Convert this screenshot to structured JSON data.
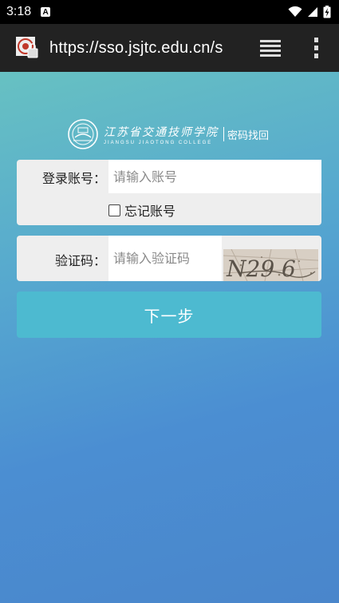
{
  "status_bar": {
    "time": "3:18",
    "notification_badge": "A",
    "icons": [
      "wifi-icon",
      "signal-icon",
      "battery-charging-icon"
    ]
  },
  "browser": {
    "url": "https://sso.jsjtc.edu.cn/s",
    "site_icon": "site-favicon",
    "tabs_icon": "tabs-icon",
    "menu_icon": "more-vert-icon"
  },
  "header": {
    "school_name_cn": "江苏省交通技师学院",
    "school_name_en": "JIANGSU JIAOTONG COLLEGE",
    "reset_password_link": "密码找回"
  },
  "login_form": {
    "account_label": "登录账号：",
    "account_placeholder": "请输入账号",
    "account_value": "",
    "remember_checked": false,
    "remember_label": "忘记账号",
    "captcha_label": "验证码：",
    "captcha_placeholder": "请输入验证码",
    "captcha_value": "",
    "captcha_text": "N29 6",
    "next_button": "下一步"
  },
  "colors": {
    "gradient_top": "#67c1c2",
    "gradient_bottom": "#4a86cb",
    "button": "#4dbad0",
    "card": "#eeeeee"
  }
}
